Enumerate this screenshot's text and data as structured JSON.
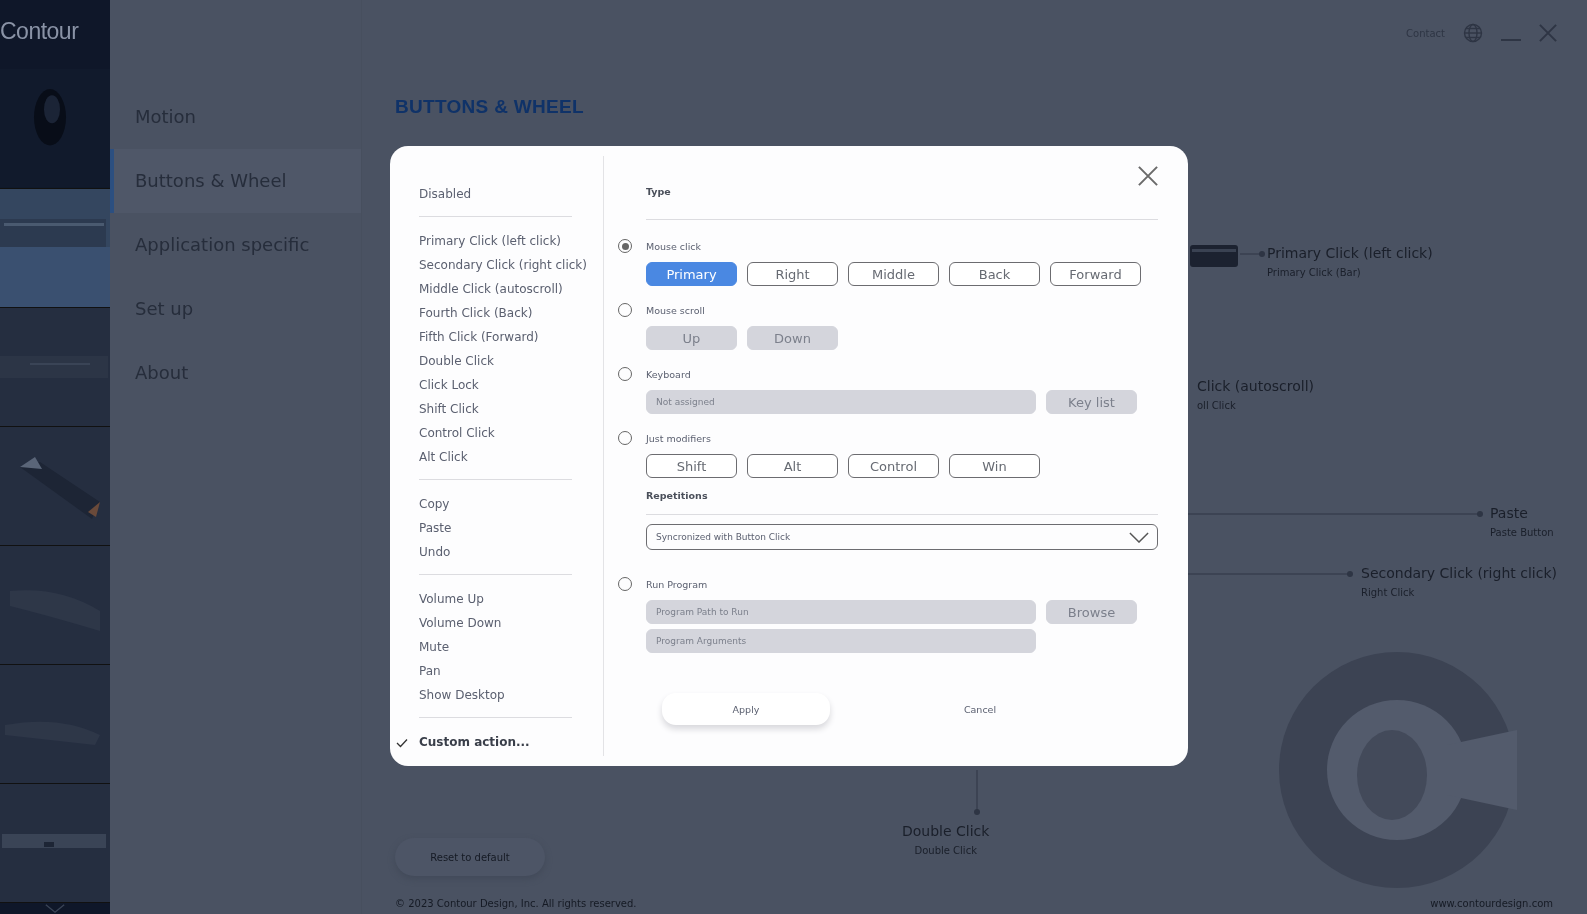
{
  "logo": "Contour",
  "thumbnails": [
    {
      "kind": "picture",
      "selected": false
    },
    {
      "kind": "picture",
      "selected": true
    },
    {
      "kind": "picture",
      "selected": false
    },
    {
      "kind": "picture",
      "selected": false
    },
    {
      "kind": "picture",
      "selected": false
    },
    {
      "kind": "picture",
      "selected": false
    },
    {
      "kind": "picture",
      "selected": false
    }
  ],
  "nav": [
    {
      "label": "Motion",
      "selected": false
    },
    {
      "label": "Buttons & Wheel",
      "selected": true
    },
    {
      "label": "Application specific",
      "selected": false
    },
    {
      "label": "Set up",
      "selected": false
    },
    {
      "label": "About",
      "selected": false
    }
  ],
  "header": {
    "title": "BUTTONS & WHEEL",
    "contact": "Contact"
  },
  "callouts": [
    {
      "label": "Primary Click (left click)",
      "sublabel": "Primary Click (Bar)",
      "kind": "right"
    },
    {
      "label": "Click (autoscroll)",
      "sublabel": "oll Click",
      "kind": "plain"
    },
    {
      "label": "Paste",
      "sublabel": "Paste Button",
      "kind": "right"
    },
    {
      "label": "Secondary Click (right click)",
      "sublabel": "Right Click",
      "kind": "right"
    },
    {
      "label": "Double Click",
      "sublabel": "Double Click",
      "kind": "down"
    }
  ],
  "reset_button": "Reset to default",
  "copyright": "© 2023 Contour Design, Inc. All rights reserved.",
  "website": "www.contourdesign.com",
  "dialog": {
    "actions": [
      [
        {
          "label": "Disabled",
          "checked": false
        }
      ],
      [
        {
          "label": "Primary Click (left click)",
          "checked": false
        },
        {
          "label": "Secondary Click (right click)",
          "checked": false
        },
        {
          "label": "Middle Click (autoscroll)",
          "checked": false
        },
        {
          "label": "Fourth Click (Back)",
          "checked": false
        },
        {
          "label": "Fifth Click (Forward)",
          "checked": false
        },
        {
          "label": "Double Click",
          "checked": false
        },
        {
          "label": "Click Lock",
          "checked": false
        },
        {
          "label": "Shift Click",
          "checked": false
        },
        {
          "label": "Control Click",
          "checked": false
        },
        {
          "label": "Alt Click",
          "checked": false
        }
      ],
      [
        {
          "label": "Copy",
          "checked": false
        },
        {
          "label": "Paste",
          "checked": false
        },
        {
          "label": "Undo",
          "checked": false
        }
      ],
      [
        {
          "label": "Volume Up",
          "checked": false
        },
        {
          "label": "Volume Down",
          "checked": false
        },
        {
          "label": "Mute",
          "checked": false
        },
        {
          "label": "Pan",
          "checked": false
        },
        {
          "label": "Show Desktop",
          "checked": false
        }
      ],
      [
        {
          "label": "Custom action...",
          "checked": true
        }
      ]
    ],
    "type_heading": "Type",
    "options": [
      {
        "kind": "buttons",
        "label": "Mouse click",
        "selected": true,
        "disabled": false,
        "buttons": [
          {
            "label": "Primary",
            "selected": true
          },
          {
            "label": "Right",
            "selected": false
          },
          {
            "label": "Middle",
            "selected": false
          },
          {
            "label": "Back",
            "selected": false
          },
          {
            "label": "Forward",
            "selected": false
          }
        ]
      },
      {
        "kind": "buttons",
        "label": "Mouse scroll",
        "selected": false,
        "disabled": true,
        "buttons": [
          {
            "label": "Up"
          },
          {
            "label": "Down"
          }
        ]
      },
      {
        "kind": "fields",
        "label": "Keyboard",
        "selected": false,
        "disabled": true,
        "fields": [
          {
            "placeholder": "Not assigned"
          }
        ],
        "button": "Key list"
      },
      {
        "kind": "buttons",
        "label": "Just modifiers",
        "selected": false,
        "disabled": false,
        "buttons": [
          {
            "label": "Shift",
            "selected": false
          },
          {
            "label": "Alt",
            "selected": false
          },
          {
            "label": "Control",
            "selected": false
          },
          {
            "label": "Win",
            "selected": false
          }
        ]
      },
      {
        "kind": "dropdown",
        "label": "Repetitions",
        "value": "Syncronized with Button Click"
      },
      {
        "kind": "fields",
        "label": "Run Program",
        "selected": false,
        "disabled": true,
        "fields": [
          {
            "placeholder": "Program Path to Run"
          },
          {
            "placeholder": "Program Arguments"
          }
        ],
        "button": "Browse"
      }
    ],
    "apply": "Apply",
    "cancel": "Cancel"
  }
}
